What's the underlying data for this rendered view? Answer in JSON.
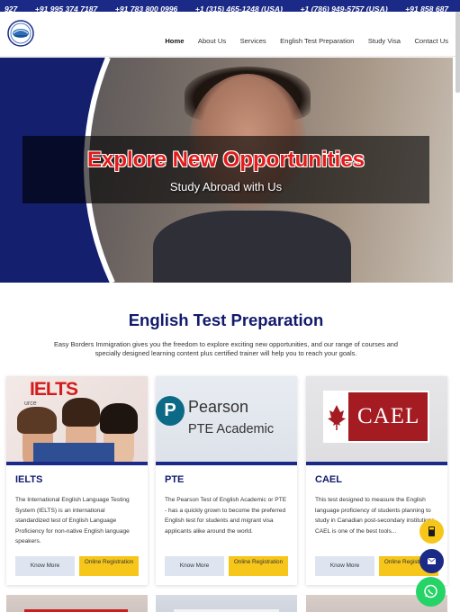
{
  "topbar": {
    "phones": [
      "927",
      "+91 995 374 7187",
      "+91 783 800 0996",
      "+1 (315) 465-1248 (USA)",
      "+1 (786) 949-5757 (USA)",
      "+91 858 687"
    ]
  },
  "nav": {
    "items": [
      "Home",
      "About Us",
      "Services",
      "English Test Preparation",
      "Study Visa",
      "Contact Us"
    ],
    "active": "Home"
  },
  "hero": {
    "title": "Explore New Opportunities",
    "subtitle": "Study Abroad with Us"
  },
  "section": {
    "title": "English Test Preparation",
    "description": "Easy Borders Immigration gives you the freedom to explore exciting new opportunities, and our range of courses and specially designed learning content plus certified trainer will help you to reach your goals."
  },
  "cards": [
    {
      "name": "IELTS",
      "image_text": "IELTS",
      "image_sub": "urce",
      "description": "The International English Language Testing System (IELTS) is an international standardized test of English Language Proficiency for non-native English language speakers.",
      "know_more": "Know More",
      "register": "Online Registration"
    },
    {
      "name": "PTE",
      "image_text_1": "Pearson",
      "image_text_2": "PTE Academic",
      "image_letter": "P",
      "description": "The Pearson Test of English Academic or PTE - has a quickly grown to become the preferred English test for students and migrant visa applicants alike around the world.",
      "know_more": "Know More",
      "register": "Online Registration"
    },
    {
      "name": "CAEL",
      "image_text": "CAEL",
      "description": "This test designed to measure the English language proficiency of students planning to study in Canadian post-secondary institutions. CAEL is one of the best tools...",
      "know_more": "Know More",
      "register": "Online Registration"
    }
  ],
  "floating": {
    "calculator_icon": "calculator-icon",
    "mail_icon": "envelope-icon",
    "whatsapp_icon": "whatsapp-icon"
  },
  "colors": {
    "brand_navy": "#1b2a86",
    "accent_yellow": "#f7c61a",
    "hero_red": "#e31b1b",
    "whatsapp_green": "#25d366"
  }
}
